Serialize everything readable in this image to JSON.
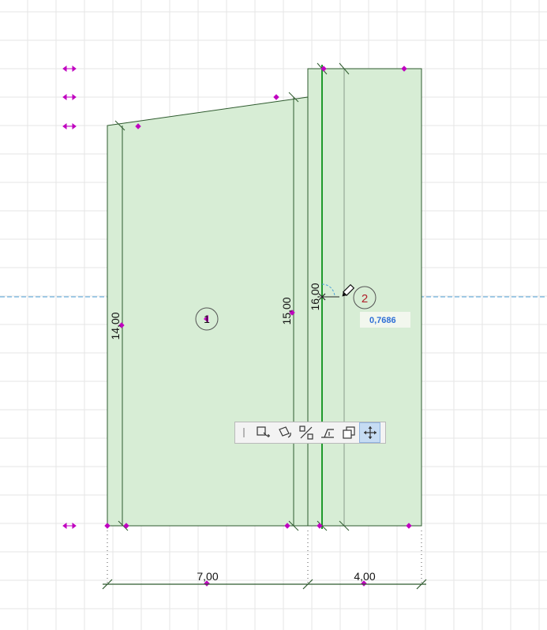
{
  "dimensions": {
    "bottom_left": "7,00",
    "bottom_right": "4,00",
    "height_left": "14,00",
    "height_middle": "15,00",
    "height_right": "16,00"
  },
  "zones": {
    "zone1_number": "1",
    "zone2_number": "2"
  },
  "tracker": {
    "value": "0,7686"
  },
  "toolbar": {
    "tools": [
      {
        "icon": "separator-icon",
        "active": false
      },
      {
        "icon": "move-node-icon",
        "active": false
      },
      {
        "icon": "rotate-icon",
        "active": false
      },
      {
        "icon": "offset-edge-icon",
        "active": false
      },
      {
        "icon": "elevation-icon",
        "active": false
      },
      {
        "icon": "duplicate-icon",
        "active": false
      },
      {
        "icon": "move-icon",
        "active": true
      }
    ]
  },
  "colors": {
    "fill": "#d7edd5",
    "outline": "#2e5a2e",
    "grid": "#e6e6e6",
    "guide": "#4fa3d8",
    "handle": "#c000c0",
    "highlight_line": "#1f9a2c",
    "value_text": "#2f6fd6"
  }
}
